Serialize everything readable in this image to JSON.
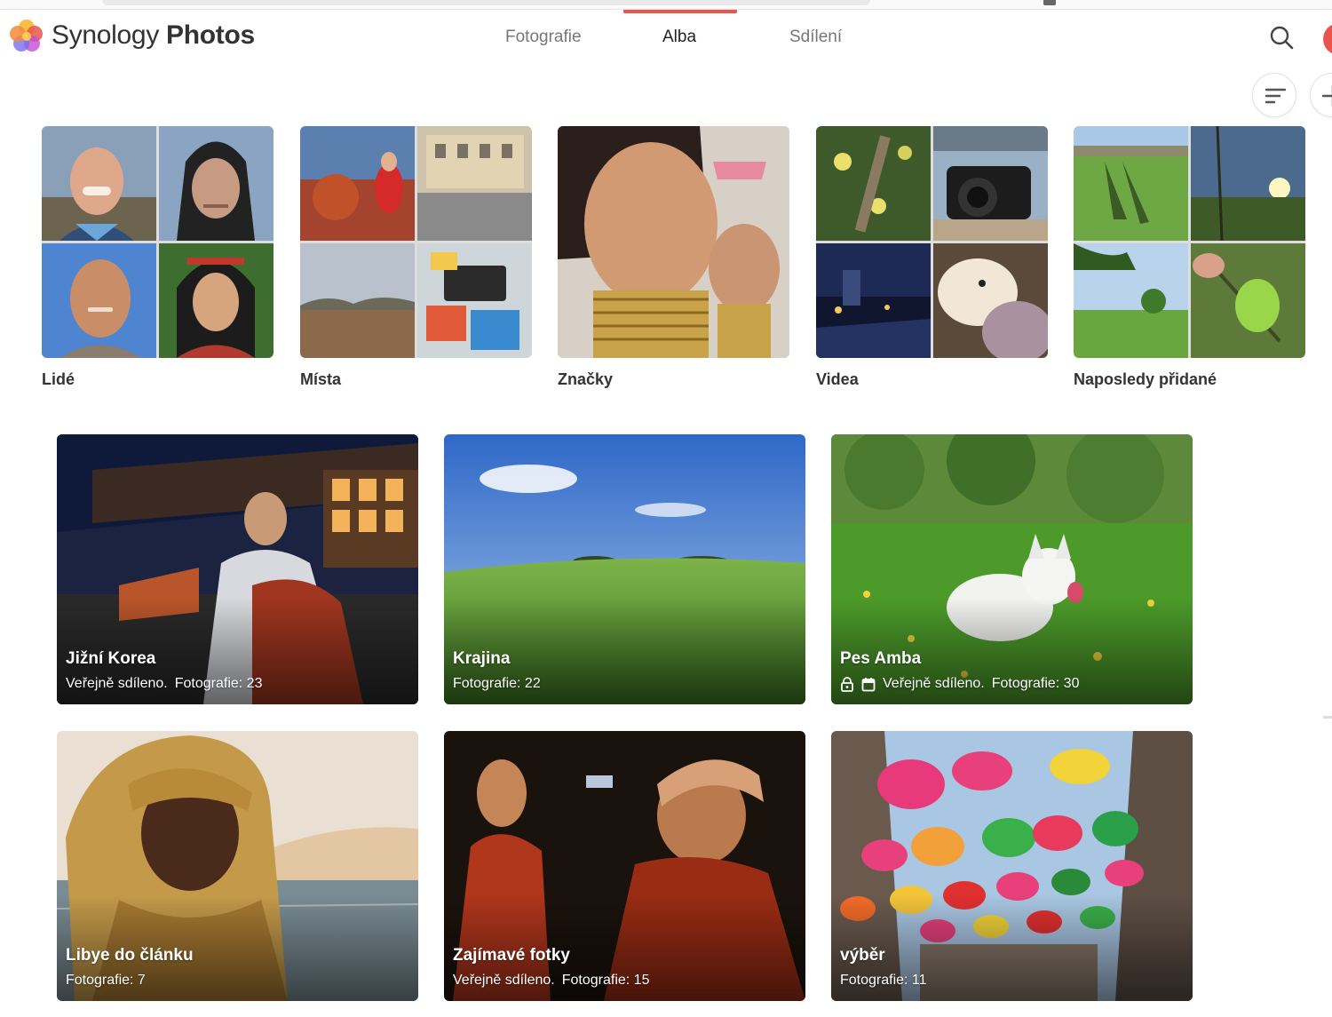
{
  "app": {
    "brand_light": "Synology",
    "brand_bold": "Photos",
    "accent_color": "#e8554e"
  },
  "nav": {
    "tabs": [
      {
        "label": "Fotografie"
      },
      {
        "label": "Alba",
        "active": true
      },
      {
        "label": "Sdílení"
      }
    ]
  },
  "toolbar": {
    "search_icon": "search-icon",
    "sort_icon": "sort-icon",
    "add_icon": "plus-icon"
  },
  "smart_albums": [
    {
      "label": "Lidé"
    },
    {
      "label": "Místa"
    },
    {
      "label": "Značky"
    },
    {
      "label": "Videa"
    },
    {
      "label": "Naposledy přidané"
    }
  ],
  "albums": [
    {
      "title": "Jižní Korea",
      "shared": "Veřejně sdíleno.",
      "count": "Fotografie: 23"
    },
    {
      "title": "Krajina",
      "count": "Fotografie: 22"
    },
    {
      "title": "Pes Amba",
      "shared": "Veřejně sdíleno.",
      "count": "Fotografie: 30",
      "icons": [
        "lock-icon",
        "calendar-icon"
      ]
    },
    {
      "title": "Libye do článku",
      "count": "Fotografie: 7"
    },
    {
      "title": "Zajímavé fotky",
      "shared": "Veřejně sdíleno.",
      "count": "Fotografie: 15"
    },
    {
      "title": "výběr",
      "count": "Fotografie: 11"
    }
  ]
}
